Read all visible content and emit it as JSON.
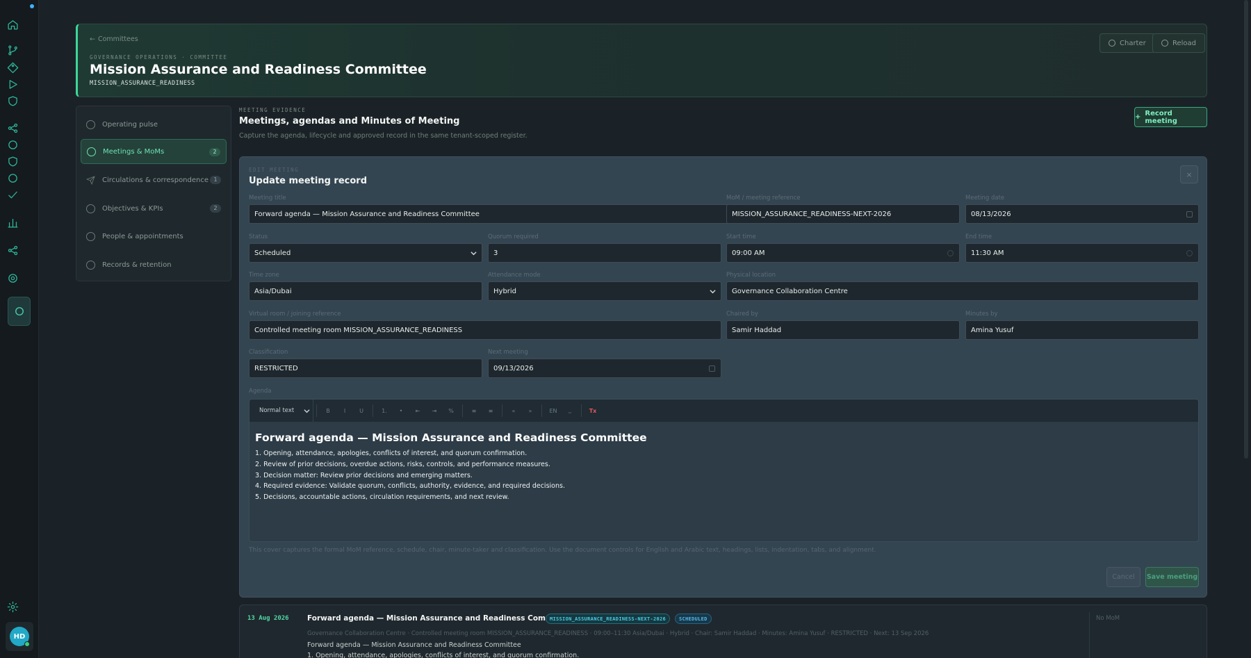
{
  "header": {
    "breadcrumb": "Committees",
    "eyebrow": "GOVERNANCE OPERATIONS · COMMITTEE",
    "title": "Mission Assurance and Readiness Committee",
    "code": "MISSION_ASSURANCE_READINESS",
    "charter_label": "Charter",
    "reload_label": "Reload"
  },
  "nav": [
    {
      "label": "Operating pulse",
      "count": ""
    },
    {
      "label": "Meetings & MoMs",
      "count": "2"
    },
    {
      "label": "Circulations & correspondence",
      "count": "1"
    },
    {
      "label": "Objectives & KPIs",
      "count": "2"
    },
    {
      "label": "People & appointments",
      "count": ""
    },
    {
      "label": "Records & retention",
      "count": ""
    }
  ],
  "section": {
    "eyebrow": "MEETING EVIDENCE",
    "title": "Meetings, agendas and Minutes of Meeting",
    "subtitle": "Capture the agenda, lifecycle and approved record in the same tenant-scoped register.",
    "record_label": "Record meeting"
  },
  "form": {
    "eyebrow": "EDIT MEETING",
    "title": "Update meeting record",
    "close": "×",
    "labels": {
      "meeting_title": "Meeting title",
      "mom_ref": "MoM / meeting reference",
      "meeting_date": "Meeting date",
      "status": "Status",
      "quorum": "Quorum required",
      "start_time": "Start time",
      "end_time": "End time",
      "time_zone": "Time zone",
      "attendance": "Attendance mode",
      "location": "Physical location",
      "virtual": "Virtual room / joining reference",
      "chaired_by": "Chaired by",
      "minutes_by": "Minutes by",
      "classification": "Classification",
      "next_meeting": "Next meeting",
      "agenda": "Agenda"
    },
    "values": {
      "meeting_title": "Forward agenda — Mission Assurance and Readiness Committee",
      "mom_ref": "MISSION_ASSURANCE_READINESS-NEXT-2026",
      "meeting_date": "08/13/2026",
      "status": "Scheduled",
      "quorum": "3",
      "start_time": "09:00 AM",
      "end_time": "11:30 AM",
      "time_zone": "Asia/Dubai",
      "attendance": "Hybrid",
      "location": "Governance Collaboration Centre",
      "virtual": "Controlled meeting room MISSION_ASSURANCE_READINESS",
      "chaired_by": "Samir Haddad",
      "minutes_by": "Amina Yusuf",
      "classification": "RESTRICTED",
      "next_meeting": "09/13/2026"
    },
    "toolbar": {
      "style": "Normal text",
      "buttons": [
        "B",
        "I",
        "U",
        "1.",
        "•",
        "⇤",
        "⇥",
        "%",
        "≡",
        "≡",
        "«",
        "»",
        "EN",
        "⎵",
        "Tx"
      ]
    },
    "agenda": {
      "heading": "Forward agenda — Mission Assurance and Readiness Committee",
      "items": [
        "1. Opening, attendance, apologies, conflicts of interest, and quorum confirmation.",
        "2. Review of prior decisions, overdue actions, risks, controls, and performance measures.",
        "3. Decision matter: Review prior decisions and emerging matters.",
        "4. Required evidence: Validate quorum, conflicts, authority, evidence, and required decisions.",
        "5. Decisions, accountable actions, circulation requirements, and next review."
      ]
    },
    "help": "This cover captures the formal MoM reference, schedule, chair, minute-taker and classification. Use the document controls for English and Arabic text, headings, lists, indentation, tabs, and alignment.",
    "cancel_label": "Cancel",
    "save_label": "Save meeting"
  },
  "meeting": {
    "date": "13 Aug 2026",
    "title": "Forward agenda — Mission Assurance and Readiness Committee",
    "code_badge": "MISSION_ASSURANCE_READINESS-NEXT-2026",
    "status_badge": "SCHEDULED",
    "meta": "Governance Collaboration Centre · Controlled meeting room MISSION_ASSURANCE_READINESS · 09:00–11:30 Asia/Dubai · Hybrid · Chair: Samir Haddad · Minutes: Amina Yusuf · RESTRICTED · Next: 13 Sep 2026",
    "line1": "Forward agenda — Mission Assurance and Readiness Committee",
    "line2": "1. Opening, attendance, apologies, conflicts of interest, and quorum confirmation.",
    "mom": "No MoM"
  },
  "user": {
    "initials": "HD"
  },
  "colors": {
    "accent": "#3ed79a",
    "background": "#1b2227",
    "panel": "#344552"
  }
}
